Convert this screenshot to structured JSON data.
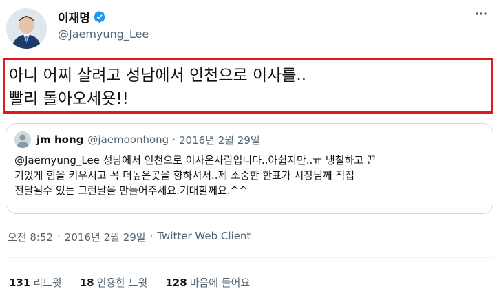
{
  "author": {
    "display_name": "이재명",
    "handle": "@Jaemyung_Lee",
    "verified_icon": "verified-badge-icon"
  },
  "more_icon": "more-options-icon",
  "tweet": {
    "lines": [
      "아니 어찌 살려고 성남에서 인천으로 이사를..",
      "빨리 돌아오세욧!!"
    ],
    "highlight_color": "#e0191f"
  },
  "quote": {
    "name": "jm hong",
    "handle": "@jaemoonhong",
    "separator": "·",
    "date": "2016년 2월 29일",
    "lines": [
      "@Jaemyung_Lee 성남에서 인천으로 이사온사람입니다..아쉽지만..ㅠ 냉철하고 끈",
      "기있게 힘을 키우시고 꼭 더높은곳을 향하셔서..제 소중한 한표가 시장님께 직접",
      "전달될수 있는 그런날을 만들어주세요.기대할께요.^^"
    ]
  },
  "meta": {
    "time": "오전 8:52",
    "separator1": "·",
    "date": "2016년 2월 29일",
    "separator2": "·",
    "client": "Twitter Web Client"
  },
  "stats": {
    "retweets_count": "131",
    "retweets_label": "리트윗",
    "quotes_count": "18",
    "quotes_label": "인용한 트윗",
    "likes_count": "128",
    "likes_label": "마음에 들어요"
  },
  "colors": {
    "text": "#0f1419",
    "secondary": "#536471",
    "verified": "#1d9bf0",
    "border": "#cfd9de"
  }
}
